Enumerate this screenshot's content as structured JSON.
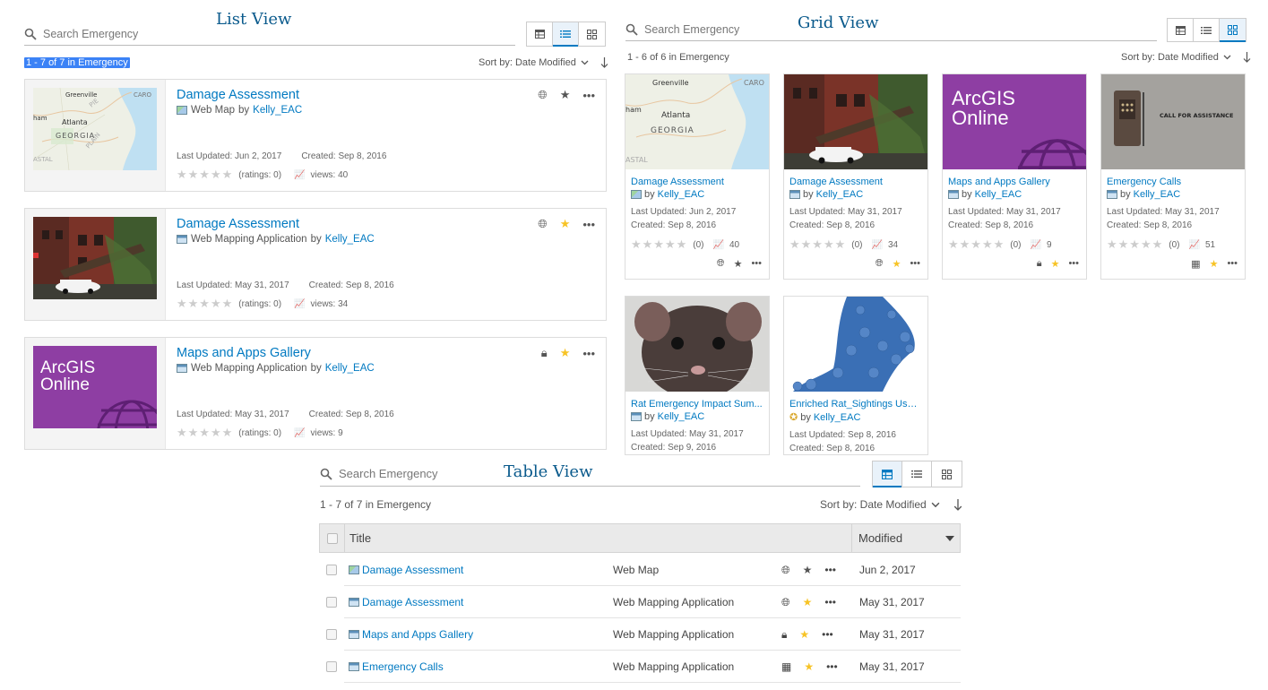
{
  "list_view": {
    "title": "List View",
    "search_placeholder": "Search Emergency",
    "count": "1 - 7 of 7 in Emergency",
    "sort_label": "Sort by: Date Modified",
    "items": [
      {
        "title": "Damage Assessment",
        "type": "Web Map",
        "by": "by",
        "owner": "Kelly_EAC",
        "updated": "Last Updated: Jun 2, 2017",
        "created": "Created: Sep 8, 2016",
        "ratings": "(ratings: 0)",
        "views": "views: 40",
        "access_icon": "globe-icon",
        "favorite": false
      },
      {
        "title": "Damage Assessment",
        "type": "Web Mapping Application",
        "by": "by",
        "owner": "Kelly_EAC",
        "updated": "Last Updated: May 31, 2017",
        "created": "Created: Sep 8, 2016",
        "ratings": "(ratings: 0)",
        "views": "views: 34",
        "access_icon": "globe-icon",
        "favorite": true
      },
      {
        "title": "Maps and Apps Gallery",
        "type": "Web Mapping Application",
        "by": "by",
        "owner": "Kelly_EAC",
        "updated": "Last Updated: May 31, 2017",
        "created": "Created: Sep 8, 2016",
        "ratings": "(ratings: 0)",
        "views": "views: 9",
        "access_icon": "lock-icon",
        "favorite": true
      }
    ]
  },
  "grid_view": {
    "title": "Grid View",
    "search_placeholder": "Search Emergency",
    "count": "1 - 6 of 6 in Emergency",
    "sort_label": "Sort by: Date Modified",
    "items": [
      {
        "title": "Damage Assessment",
        "owner": "Kelly_EAC",
        "updated": "Last Updated: Jun 2, 2017",
        "created": "Created: Sep 8, 2016",
        "ratings": "(0)",
        "views": "40",
        "access_icon": "globe-icon",
        "favorite": false
      },
      {
        "title": "Damage Assessment",
        "owner": "Kelly_EAC",
        "updated": "Last Updated: May 31, 2017",
        "created": "Created: Sep 8, 2016",
        "ratings": "(0)",
        "views": "34",
        "access_icon": "globe-icon",
        "favorite": true
      },
      {
        "title": "Maps and Apps Gallery",
        "owner": "Kelly_EAC",
        "updated": "Last Updated: May 31, 2017",
        "created": "Created: Sep 8, 2016",
        "ratings": "(0)",
        "views": "9",
        "access_icon": "lock-icon",
        "favorite": true
      },
      {
        "title": "Emergency Calls",
        "owner": "Kelly_EAC",
        "updated": "Last Updated: May 31, 2017",
        "created": "Created: Sep 8, 2016",
        "ratings": "(0)",
        "views": "51",
        "access_icon": "organization-icon",
        "favorite": true
      },
      {
        "title": "Rat Emergency Impact Sum...",
        "owner": "Kelly_EAC",
        "updated": "Last Updated: May 31, 2017",
        "created": "Created: Sep 9, 2016"
      },
      {
        "title": "Enriched Rat_Sightings Usage",
        "owner": "Kelly_EAC",
        "updated": "Last Updated: Sep 8, 2016",
        "created": "Created: Sep 8, 2016"
      }
    ],
    "by": "by"
  },
  "table_view": {
    "title": "Table View",
    "search_placeholder": "Search Emergency",
    "count": "1 - 7 of 7 in Emergency",
    "sort_label": "Sort by: Date Modified",
    "columns": {
      "title": "Title",
      "modified": "Modified"
    },
    "rows": [
      {
        "title": "Damage Assessment",
        "type": "Web Map",
        "modified": "Jun 2, 2017",
        "access_icon": "globe-icon",
        "favorite": false
      },
      {
        "title": "Damage Assessment",
        "type": "Web Mapping Application",
        "modified": "May 31, 2017",
        "access_icon": "globe-icon",
        "favorite": true
      },
      {
        "title": "Maps and Apps Gallery",
        "type": "Web Mapping Application",
        "modified": "May 31, 2017",
        "access_icon": "lock-icon",
        "favorite": true
      },
      {
        "title": "Emergency Calls",
        "type": "Web Mapping Application",
        "modified": "May 31, 2017",
        "access_icon": "organization-icon",
        "favorite": true
      }
    ]
  },
  "thumbnails": {
    "map_labels": [
      "Greenville",
      "Atlanta",
      "GEORGIA",
      "ham",
      "CARO",
      "PIE",
      "PLAIN",
      "ASTAL"
    ],
    "arcgis_text": [
      "ArcGIS",
      "Online"
    ],
    "callbox_text": "CALL FOR ASSISTANCE"
  },
  "colors": {
    "accent": "#0079c1",
    "favorite": "#f7c325",
    "arcgis_purple": "#8e3ea3",
    "selection": "#3b82f6"
  }
}
